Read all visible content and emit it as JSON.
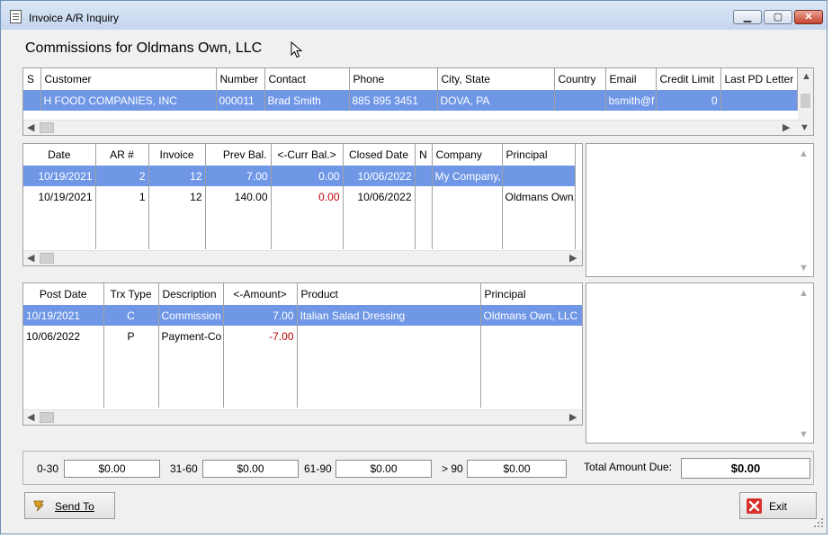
{
  "window": {
    "title": "Invoice A/R Inquiry"
  },
  "heading": "Commissions for Oldmans Own, LLC",
  "customer_grid": {
    "columns": [
      "S",
      "Customer",
      "Number",
      "Contact",
      "Phone",
      "City, State",
      "Country",
      "Email",
      "Credit Limit",
      "Last PD Letter P"
    ],
    "rows": [
      {
        "s": "",
        "customer": "H FOOD COMPANIES, INC",
        "number": "000011",
        "contact": "Brad Smith",
        "phone": "885 895 3451",
        "city_state": "DOVA, PA",
        "country": "",
        "email": "bsmith@f",
        "credit_limit": "0",
        "last_pd": ""
      }
    ]
  },
  "ar_grid": {
    "columns": [
      "Date",
      "AR #",
      "Invoice",
      "Prev Bal.",
      "<-Curr Bal.>",
      "Closed Date",
      "N",
      "Company",
      "Principal"
    ],
    "rows": [
      {
        "date": "10/19/2021",
        "ar": "2",
        "invoice": "12",
        "prev_bal": "7.00",
        "curr_bal": "0.00",
        "closed": "10/06/2022",
        "n": "",
        "company": "My Company,",
        "principal": ""
      },
      {
        "date": "10/19/2021",
        "ar": "1",
        "invoice": "12",
        "prev_bal": "140.00",
        "curr_bal": "0.00",
        "closed": "10/06/2022",
        "n": "",
        "company": "",
        "principal": "Oldmans Own,"
      }
    ]
  },
  "trx_grid": {
    "columns": [
      "Post Date",
      "Trx Type",
      "Description",
      "<-Amount>",
      "Product",
      "Principal"
    ],
    "rows": [
      {
        "post_date": "10/19/2021",
        "trx_type": "C",
        "description": "Commission",
        "amount": "7.00",
        "product": "Italian Salad Dressing",
        "principal": "Oldmans Own, LLC"
      },
      {
        "post_date": "10/06/2022",
        "trx_type": "P",
        "description": "Payment-Co",
        "amount": "-7.00",
        "product": "",
        "principal": ""
      }
    ]
  },
  "aging": {
    "b1_label": "0-30",
    "b1_value": "$0.00",
    "b2_label": "31-60",
    "b2_value": "$0.00",
    "b3_label": "61-90",
    "b3_value": "$0.00",
    "b4_label": "> 90",
    "b4_value": "$0.00",
    "total_label": "Total Amount Due:",
    "total_value": "$0.00"
  },
  "buttons": {
    "send_to": "Send To",
    "exit": "Exit"
  },
  "colors": {
    "selection": "#6f97e6",
    "negative": "#c00000",
    "exit_icon": "#d9302c",
    "send_icon": "#e0a020"
  },
  "icons": [
    "document-icon",
    "minimize-icon",
    "maximize-icon",
    "close-icon",
    "mouse-cursor-icon",
    "send-icon",
    "exit-icon"
  ]
}
